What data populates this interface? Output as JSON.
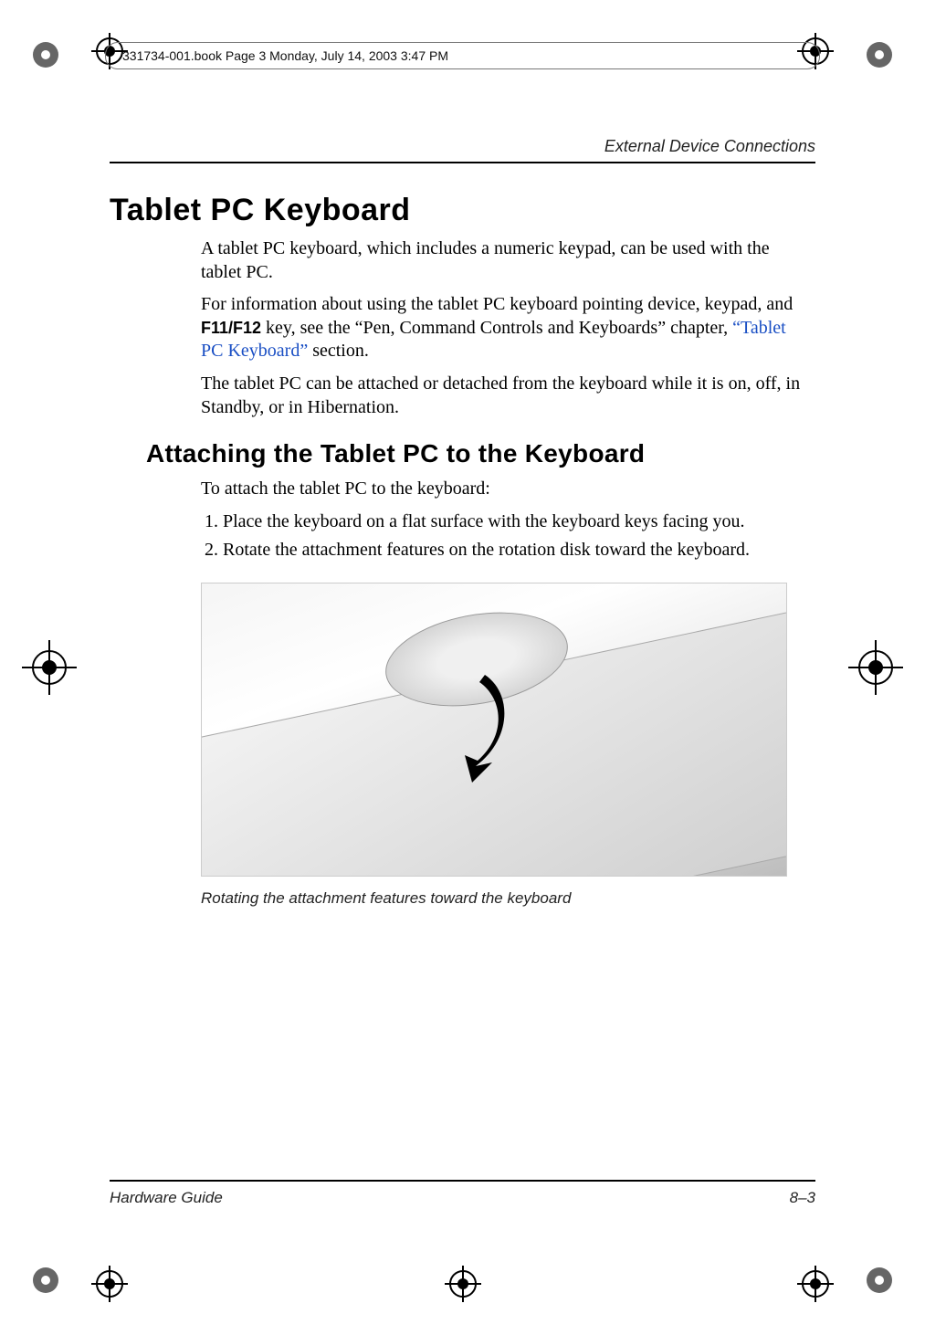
{
  "print": {
    "file_info": "331734-001.book  Page 3  Monday, July 14, 2003  3:47 PM"
  },
  "page": {
    "running_header": "External Device Connections",
    "title": "Tablet PC Keyboard",
    "intro_p1": "A tablet PC keyboard, which includes a numeric keypad, can be used with the tablet PC.",
    "intro_p2a": "For information about using the tablet PC keyboard pointing device, keypad, and ",
    "intro_p2_key": "F11/F12",
    "intro_p2b": " key, see the “Pen, Command Controls and Keyboards” chapter, ",
    "intro_p2_link": "“Tablet PC Keyboard”",
    "intro_p2c": " section.",
    "intro_p3": "The tablet PC can be attached or detached from the keyboard while it is on, off, in Standby, or in Hibernation.",
    "subsection": "Attaching the Tablet PC to the Keyboard",
    "lead": "To attach the tablet PC to the keyboard:",
    "steps": [
      "Place the keyboard on a flat surface with the keyboard keys facing you.",
      "Rotate the attachment features on the rotation disk toward the keyboard."
    ],
    "figure_caption": "Rotating the attachment features toward the keyboard",
    "footer_left": "Hardware Guide",
    "footer_right": "8–3"
  }
}
